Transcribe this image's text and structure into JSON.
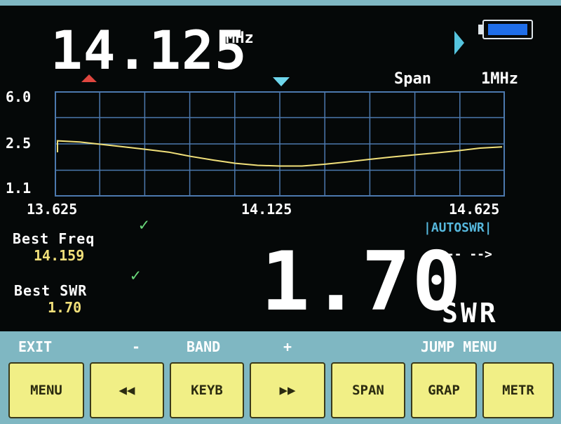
{
  "header": {
    "frequency": "14.125",
    "frequency_unit": "MHz",
    "span_label": "Span",
    "span_value": "1MHz"
  },
  "icons": [
    "play-icon",
    "battery-icon",
    "marker-red-up-icon",
    "marker-cyan-down-icon",
    "check-icon",
    "rewind-icon",
    "fast-forward-icon"
  ],
  "colors": {
    "trace": "#f1e07a",
    "grid": "#4c79ae",
    "accent": "#56b8dd",
    "button": "#f1ef86",
    "marker_red": "#e0463f",
    "marker_cyan": "#6ed6ec"
  },
  "chart_data": {
    "type": "line",
    "y_ticks": [
      "6.0",
      "2.5",
      "1.1"
    ],
    "x_ticks": [
      "13.625",
      "14.125",
      "14.625"
    ],
    "x": [
      13.625,
      13.675,
      13.725,
      13.775,
      13.825,
      13.875,
      13.925,
      13.975,
      14.025,
      14.075,
      14.125,
      14.175,
      14.225,
      14.275,
      14.325,
      14.375,
      14.425,
      14.475,
      14.525,
      14.575,
      14.625
    ],
    "y": [
      2.7,
      2.65,
      2.55,
      2.45,
      2.35,
      2.25,
      2.1,
      1.98,
      1.88,
      1.82,
      1.8,
      1.8,
      1.85,
      1.92,
      2.0,
      2.08,
      2.15,
      2.22,
      2.3,
      2.4,
      2.45
    ],
    "grid": true
  },
  "best": {
    "freq_label": "Best Freq",
    "freq_value": "14.159",
    "swr_label": "Best SWR",
    "swr_value": "1.70"
  },
  "status": {
    "autoswr": "|AUTOSWR|",
    "arrows": "<-- -->"
  },
  "reading": {
    "swr_value": "1.70",
    "swr_unit": "SWR"
  },
  "function_labels": {
    "exit": "EXIT",
    "minus": "-",
    "band": "BAND",
    "plus": "+",
    "jump_menu": "JUMP MENU"
  },
  "buttons": {
    "menu": "MENU",
    "keyb": "KEYB",
    "span": "SPAN",
    "grap": "GRAP",
    "metr": "METR"
  }
}
